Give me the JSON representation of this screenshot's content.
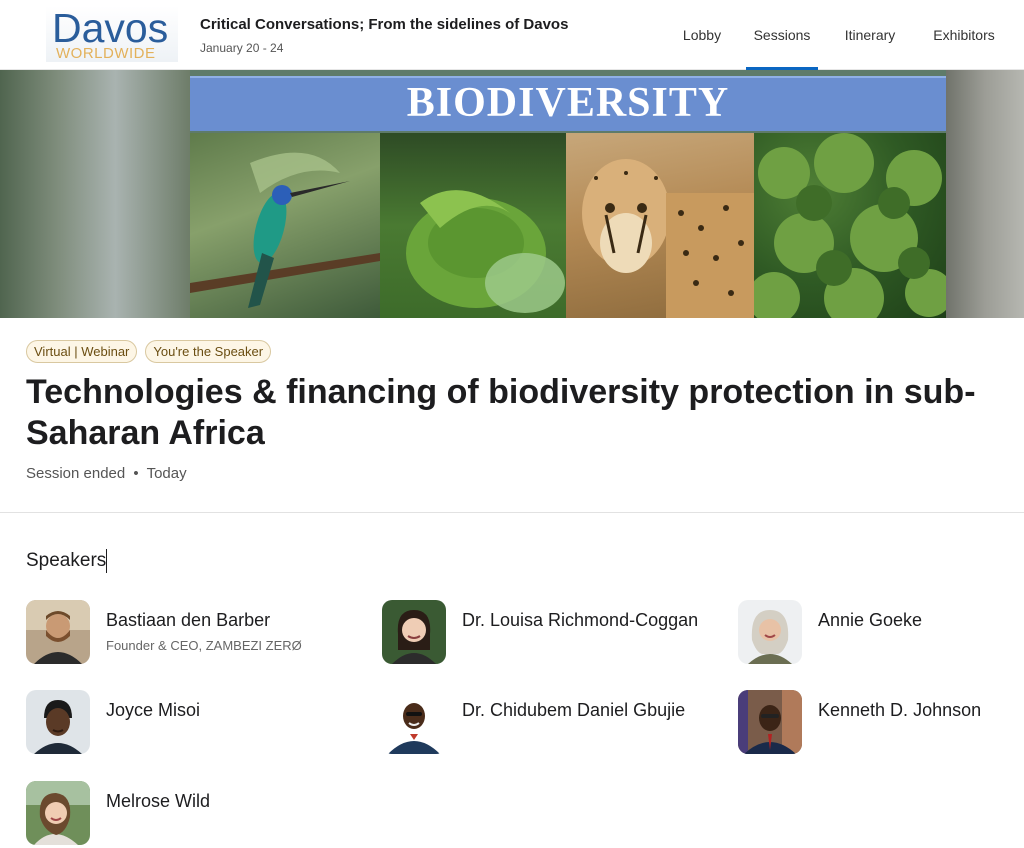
{
  "header": {
    "logo_top": "Davos",
    "logo_bottom": "WORLDWIDE",
    "event_title": "Critical Conversations; From the sidelines of Davos",
    "event_dates": "January 20 - 24",
    "nav": [
      {
        "label": "Lobby",
        "active": false
      },
      {
        "label": "Sessions",
        "active": true
      },
      {
        "label": "Itinerary",
        "active": false
      },
      {
        "label": "Exhibitors",
        "active": false
      }
    ],
    "active_color": "#0a66c2"
  },
  "banner": {
    "text": "BIODIVERSITY"
  },
  "session": {
    "tags": [
      "Virtual | Webinar",
      "You're the Speaker"
    ],
    "title": "Technologies & financing of biodiversity protection in sub-Saharan Africa",
    "status": "Session ended",
    "separator": "•",
    "when": "Today"
  },
  "speakers": {
    "heading": "Speakers",
    "items": [
      {
        "name": "Bastiaan den Barber",
        "role": "Founder & CEO, ZAMBEZI ZERØ"
      },
      {
        "name": "Dr. Louisa Richmond-Coggan",
        "role": ""
      },
      {
        "name": "Annie Goeke",
        "role": ""
      },
      {
        "name": "Joyce Misoi",
        "role": ""
      },
      {
        "name": "Dr. Chidubem Daniel Gbujie",
        "role": ""
      },
      {
        "name": "Kenneth D. Johnson",
        "role": ""
      },
      {
        "name": "Melrose Wild",
        "role": ""
      }
    ]
  }
}
